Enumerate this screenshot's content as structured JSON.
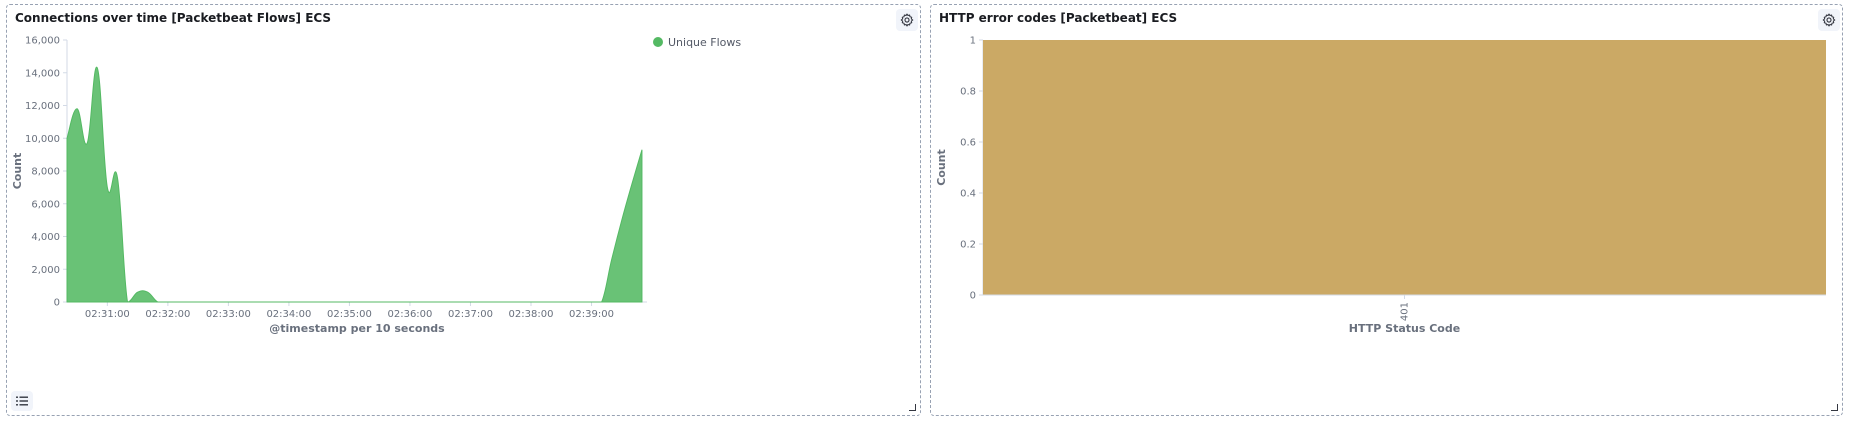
{
  "panels": {
    "connections": {
      "title": "Connections over time [Packetbeat Flows] ECS"
    },
    "http_errors": {
      "title": "HTTP error codes [Packetbeat] ECS"
    }
  },
  "chart_data": [
    {
      "type": "area",
      "title": "Connections over time [Packetbeat Flows] ECS",
      "xlabel": "@timestamp per 10 seconds",
      "ylabel": "Count",
      "ylim": [
        0,
        16000
      ],
      "yticks": [
        "0",
        "2,000",
        "4,000",
        "6,000",
        "8,000",
        "10,000",
        "12,000",
        "14,000",
        "16,000"
      ],
      "xticks": [
        "02:31:00",
        "02:32:00",
        "02:33:00",
        "02:34:00",
        "02:35:00",
        "02:36:00",
        "02:37:00",
        "02:38:00",
        "02:39:00"
      ],
      "xlim": [
        "02:30:20",
        "02:39:55"
      ],
      "legend_position": "top-right",
      "series": [
        {
          "name": "Unique Flows",
          "color": "#54b963",
          "x": [
            "02:30:20",
            "02:30:30",
            "02:30:40",
            "02:30:50",
            "02:31:00",
            "02:31:10",
            "02:31:20",
            "02:31:30",
            "02:31:40",
            "02:31:50",
            "02:32:00",
            "02:32:10",
            "02:32:20",
            "02:32:30",
            "02:32:40",
            "02:32:50",
            "02:33:00",
            "02:33:30",
            "02:34:00",
            "02:35:00",
            "02:36:00",
            "02:37:00",
            "02:38:00",
            "02:39:00",
            "02:39:10",
            "02:39:20",
            "02:39:30",
            "02:39:40",
            "02:39:50"
          ],
          "values": [
            10000,
            11800,
            9700,
            14300,
            7000,
            7600,
            0,
            600,
            600,
            0,
            0,
            0,
            0,
            0,
            0,
            0,
            0,
            0,
            0,
            0,
            0,
            0,
            0,
            0,
            0,
            2600,
            5000,
            7200,
            9300
          ]
        }
      ]
    },
    {
      "type": "bar",
      "title": "HTTP error codes [Packetbeat] ECS",
      "xlabel": "HTTP Status Code",
      "ylabel": "Count",
      "ylim": [
        0,
        1
      ],
      "yticks": [
        "0",
        "0.2",
        "0.4",
        "0.6",
        "0.8",
        "1"
      ],
      "categories": [
        "401"
      ],
      "values": [
        1
      ],
      "color": "#cba965"
    }
  ]
}
